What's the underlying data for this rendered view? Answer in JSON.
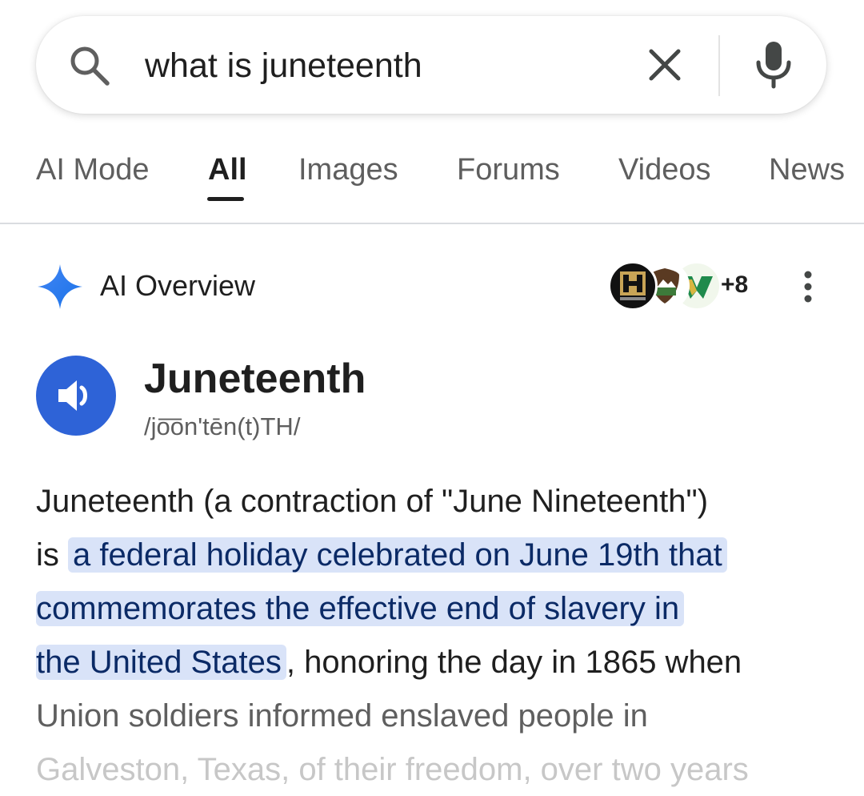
{
  "search": {
    "query": "what is juneteenth"
  },
  "tabs": [
    {
      "label": "AI Mode"
    },
    {
      "label": "All"
    },
    {
      "label": "Images"
    },
    {
      "label": "Forums"
    },
    {
      "label": "Videos"
    },
    {
      "label": "News"
    }
  ],
  "ai_overview": {
    "title": "AI Overview",
    "sources_more": "+8",
    "source_icons": [
      "history-logo",
      "nps-logo",
      "w-logo"
    ]
  },
  "word": {
    "title": "Juneteenth",
    "pronunciation": "/jo͞on'tēn(t)TH/"
  },
  "answer": {
    "line1": "Juneteenth (a contraction of \"June Nineteenth\")",
    "line2_prefix": "is ",
    "line2_highlight": "a federal holiday celebrated on June 19th that",
    "line3_highlight": "commemorates the effective end of slavery in",
    "line4_highlight": "the United States",
    "line4_rest": ", honoring the day in 1865 when",
    "line5": "Union soldiers informed enslaved people in",
    "line6": "Galveston, Texas, of their freedom, over two years"
  },
  "colors": {
    "accent_blue": "#2e63d7",
    "highlight_bg": "#d9e3f8"
  }
}
